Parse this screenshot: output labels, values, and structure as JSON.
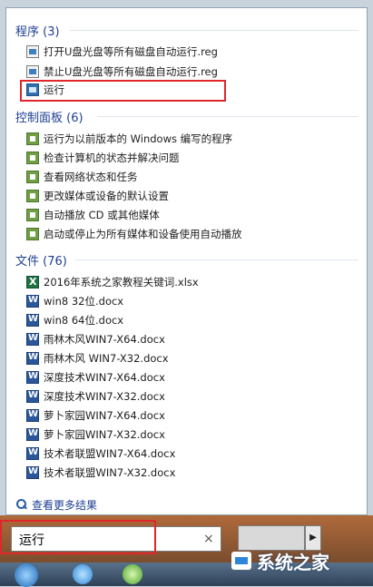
{
  "sections": [
    {
      "title": "程序 (3)",
      "items": [
        {
          "label": "打开U盘光盘等所有磁盘自动运行.reg",
          "icon": "reg-file-icon"
        },
        {
          "label": "禁止U盘光盘等所有磁盘自动运行.reg",
          "icon": "reg-file-icon"
        },
        {
          "label": "运行",
          "icon": "run-dialog-icon"
        }
      ]
    },
    {
      "title": "控制面板 (6)",
      "items": [
        {
          "label": "运行为以前版本的 Windows 编写的程序",
          "icon": "control-panel-icon"
        },
        {
          "label": "检查计算机的状态并解决问题",
          "icon": "action-center-flag-icon"
        },
        {
          "label": "查看网络状态和任务",
          "icon": "network-icon"
        },
        {
          "label": "更改媒体或设备的默认设置",
          "icon": "autoplay-icon"
        },
        {
          "label": "自动播放 CD 或其他媒体",
          "icon": "autoplay-icon"
        },
        {
          "label": "启动或停止为所有媒体和设备使用自动播放",
          "icon": "autoplay-icon"
        }
      ]
    },
    {
      "title": "文件 (76)",
      "items": [
        {
          "label": "2016年系统之家教程关键词.xlsx",
          "icon": "excel-file-icon"
        },
        {
          "label": "win8 32位.docx",
          "icon": "word-file-icon"
        },
        {
          "label": "win8 64位.docx",
          "icon": "word-file-icon"
        },
        {
          "label": "雨林木风WIN7-X64.docx",
          "icon": "word-file-icon"
        },
        {
          "label": "雨林木风 WIN7-X32.docx",
          "icon": "word-file-icon"
        },
        {
          "label": "深度技术WIN7-X64.docx",
          "icon": "word-file-icon"
        },
        {
          "label": "深度技术WIN7-X32.docx",
          "icon": "word-file-icon"
        },
        {
          "label": "萝卜家园WIN7-X64.docx",
          "icon": "word-file-icon"
        },
        {
          "label": "萝卜家园WIN7-X32.docx",
          "icon": "word-file-icon"
        },
        {
          "label": "技术者联盟WIN7-X64.docx",
          "icon": "word-file-icon"
        },
        {
          "label": "技术者联盟WIN7-X32.docx",
          "icon": "word-file-icon"
        }
      ]
    }
  ],
  "more_results": "查看更多结果",
  "search": {
    "value": "运行",
    "clear": "×"
  },
  "shutdown_arrow": "▶",
  "watermark": "系统之家",
  "colors": {
    "highlight_box": "#e0262b",
    "section_title": "#1e3f92"
  }
}
